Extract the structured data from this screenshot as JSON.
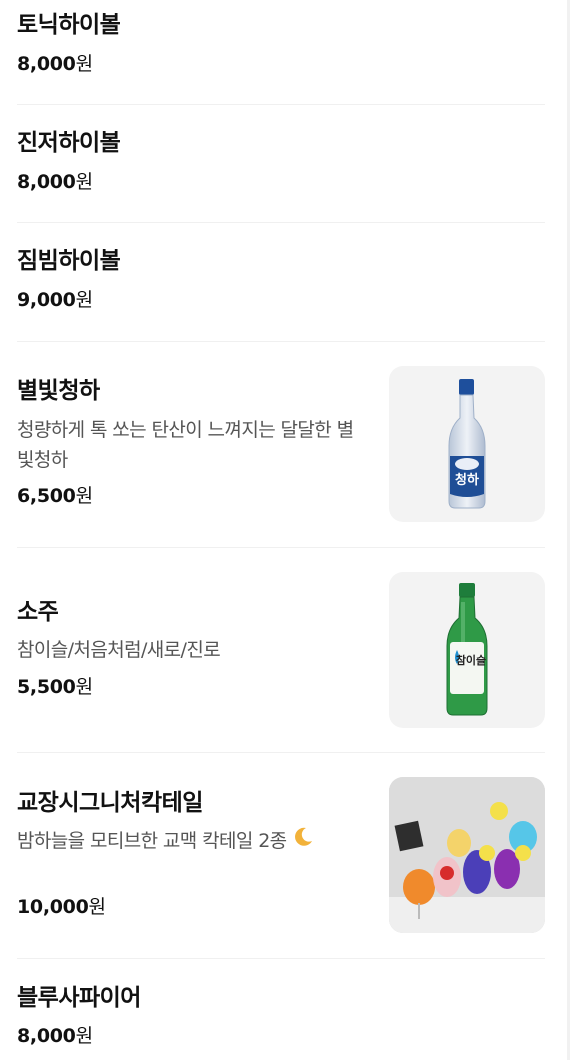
{
  "menu": {
    "currency_unit": "원",
    "items": [
      {
        "name": "토닉하이볼",
        "price": "8,000"
      },
      {
        "name": "진저하이볼",
        "price": "8,000"
      },
      {
        "name": "짐빔하이볼",
        "price": "9,000"
      },
      {
        "name": "별빛청하",
        "description": "청량하게 톡 쏘는 탄산이 느껴지는 달달한 별빛청하",
        "price": "6,500",
        "image_label": "청하"
      },
      {
        "name": "소주",
        "description": "참이슬/처음처럼/새로/진로",
        "price": "5,500",
        "image_label": "참이슬"
      },
      {
        "name": "교장시그니처칵테일",
        "description": "밤하늘을 모티브한 교맥 칵테일 2종",
        "price": "10,000",
        "description_icon": "crescent-moon-icon"
      },
      {
        "name": "블루사파이어",
        "price": "8,000"
      }
    ]
  }
}
